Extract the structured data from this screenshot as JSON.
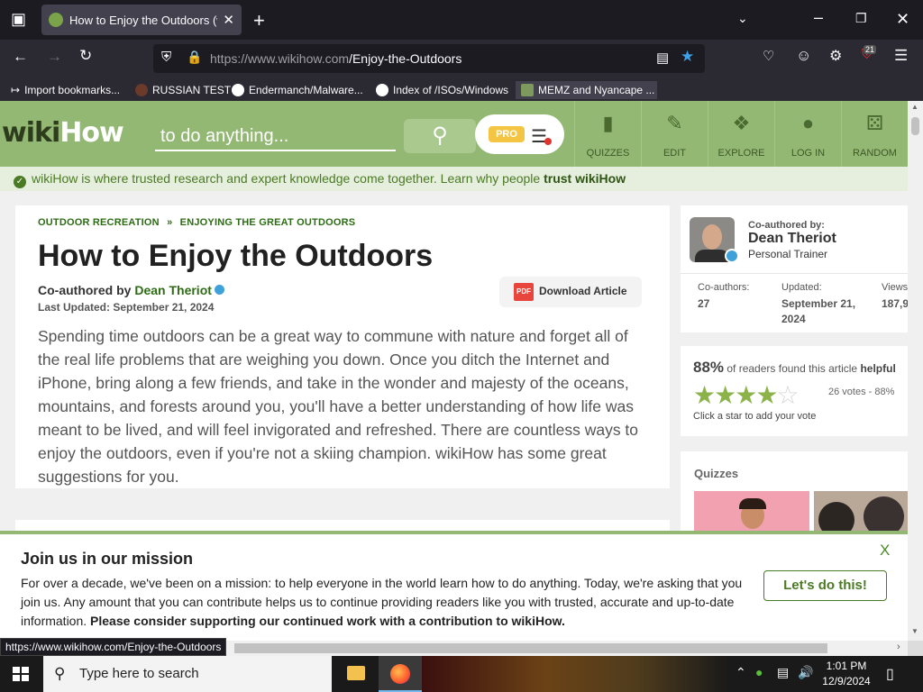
{
  "browser": {
    "tab_title": "How to Enjoy the Outdoors (with Pictures) - wikiHow",
    "url_domain": "https://www.wikihow.com",
    "url_path": "/Enjoy-the-Outdoors",
    "extension_badge": "21",
    "bookmarks": [
      {
        "label": "Import bookmarks..."
      },
      {
        "label": "RUSSIAN TEST"
      },
      {
        "label": "Endermanch/Malware..."
      },
      {
        "label": "Index of /ISOs/Windows"
      },
      {
        "label": "MEMZ and Nyancape ..."
      }
    ],
    "status_url": "https://www.wikihow.com/Enjoy-the-Outdoors"
  },
  "header": {
    "logo_wiki": "wiki",
    "logo_how": "How",
    "search_placeholder": "to do anything...",
    "pro_label": "PRO",
    "nav": [
      {
        "label": "QUIZZES",
        "icon": "quiz-icon"
      },
      {
        "label": "EDIT",
        "icon": "pencil-icon"
      },
      {
        "label": "EXPLORE",
        "icon": "compass-icon"
      },
      {
        "label": "LOG IN",
        "icon": "user-icon"
      },
      {
        "label": "RANDOM",
        "icon": "dice-icon"
      }
    ]
  },
  "trust": {
    "text": "wikiHow is where trusted research and expert knowledge come together. Learn why people ",
    "link": "trust wikiHow"
  },
  "article": {
    "crumb1": "OUTDOOR RECREATION",
    "crumb_sep": "»",
    "crumb2": "ENJOYING THE GREAT OUTDOORS",
    "title": "How to Enjoy the Outdoors",
    "coauthored_prefix": "Co-authored by ",
    "author": "Dean Theriot",
    "updated": "Last Updated: September 21, 2024",
    "download_label": "Download Article",
    "intro": "Spending time outdoors can be a great way to commune with nature and forget all of the real life problems that are weighing you down. Once you ditch the Internet and iPhone, bring along a few friends, and take in the wonder and majesty of the oceans, mountains, and forests around you, you'll have a better understanding of how life was meant to be lived, and will feel invigorated and refreshed. There are countless ways to enjoy the outdoors, even if you're not a skiing champion. wikiHow has some great suggestions for you."
  },
  "sidebar": {
    "coauthored_by": "Co-authored by:",
    "author": "Dean Theriot",
    "role": "Personal Trainer",
    "stats": [
      {
        "label": "Co-authors:",
        "value": "27"
      },
      {
        "label": "Updated:",
        "value": "September 21, 2024"
      },
      {
        "label": "Views:",
        "value": "187,9"
      }
    ],
    "helpful_pct": "88%",
    "helpful_text": " of readers found this article ",
    "helpful_bold": "helpful",
    "votes": "26 votes - 88%",
    "click_star": "Click a star to add your vote",
    "quizzes_title": "Quizzes"
  },
  "mission": {
    "title": "Join us in our mission",
    "body": "For over a decade, we've been on a mission: to help everyone in the world learn how to do anything. Today, we're asking that you join us. Any amount that you can contribute helps us to continue providing readers like you with trusted, accurate and up-to-date information. ",
    "body_bold": "Please consider supporting our continued work with a contribution to wikiHow.",
    "close": "X",
    "cta": "Let's do this!"
  },
  "taskbar": {
    "search_placeholder": "Type here to search",
    "time": "1:01 PM",
    "date": "12/9/2024"
  }
}
